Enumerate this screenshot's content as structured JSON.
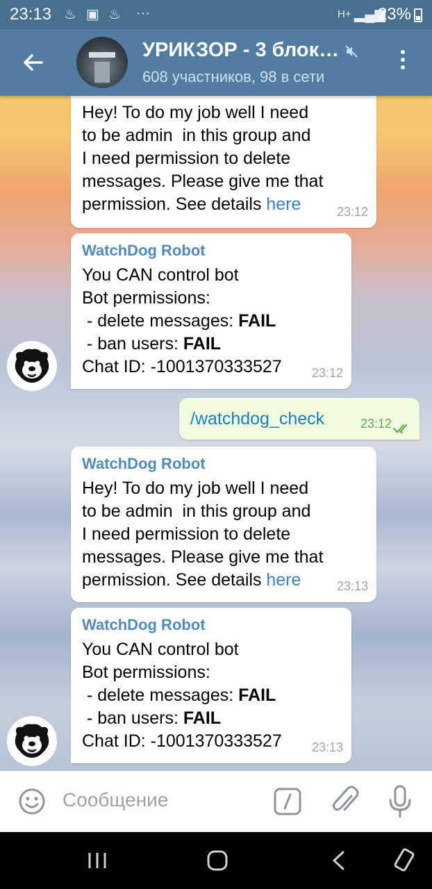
{
  "status_bar": {
    "time": "23:13",
    "icons": [
      "notification-icon",
      "image-icon",
      "notification-icon",
      "more-dots-icon"
    ],
    "network": "H+",
    "battery_percent": "23%"
  },
  "header": {
    "title": "УРИКЗОР - 3 блок…",
    "subtitle": "608 участников, 98 в сети",
    "muted": true
  },
  "messages": [
    {
      "sender": "",
      "lines": [
        "Hey! To do my job well I need",
        "to be admin  in this group and",
        "I need permission to delete",
        "messages. Please give me that"
      ],
      "last_line_prefix": "permission. See details ",
      "link": "here",
      "time": "23:12"
    },
    {
      "sender": "WatchDog Robot",
      "line1": "You CAN control bot",
      "line2": "Bot permissions:",
      "perm1_label": " - delete messages: ",
      "perm1_value": "FAIL",
      "perm2_label": " - ban users: ",
      "perm2_value": "FAIL",
      "chat_id": "Chat ID: -1001370333527",
      "time": "23:12"
    },
    {
      "outgoing": true,
      "text": "/watchdog_check",
      "time": "23:12",
      "read": true
    },
    {
      "sender": "WatchDog Robot",
      "lines": [
        "Hey! To do my job well I need",
        "to be admin  in this group and",
        "I need permission to delete",
        "messages. Please give me that"
      ],
      "last_line_prefix": "permission. See details ",
      "link": "here",
      "time": "23:13"
    },
    {
      "sender": "WatchDog Robot",
      "line1": "You CAN control bot",
      "line2": "Bot permissions:",
      "perm1_label": " - delete messages: ",
      "perm1_value": "FAIL",
      "perm2_label": " - ban users: ",
      "perm2_value": "FAIL",
      "chat_id": "Chat ID: -1001370333527",
      "time": "23:13"
    }
  ],
  "input": {
    "placeholder": "Сообщение"
  },
  "colors": {
    "header": "#517da2",
    "status_bar": "#48718f",
    "sender_name": "#4f8bbf",
    "link": "#3a82c4",
    "outgoing_bubble": "#effdde"
  }
}
